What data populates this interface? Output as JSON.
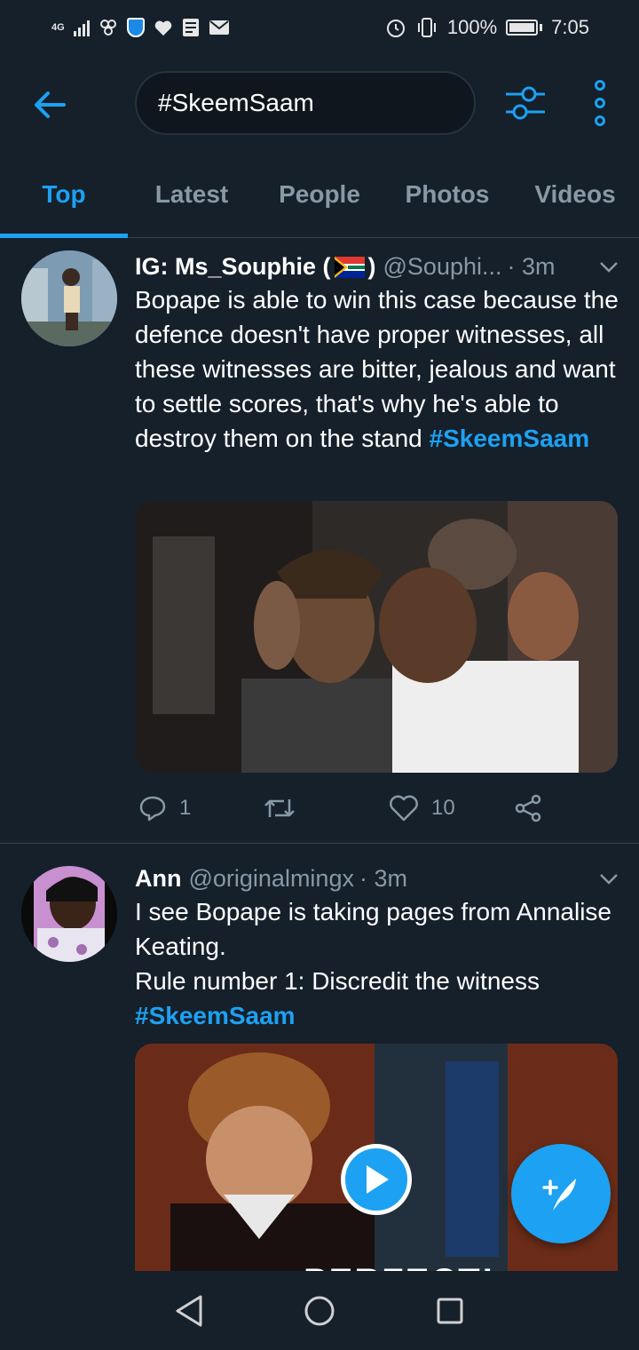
{
  "status_bar": {
    "network": "4G",
    "battery": "100%",
    "time": "7:05"
  },
  "search": {
    "query": "#SkeemSaam"
  },
  "tabs": [
    {
      "label": "Top",
      "active": true
    },
    {
      "label": "Latest",
      "active": false
    },
    {
      "label": "People",
      "active": false
    },
    {
      "label": "Photos",
      "active": false
    },
    {
      "label": "Videos",
      "active": false
    }
  ],
  "tweets": [
    {
      "author": "IG: Ms_Souphie (",
      "author_suffix": ")",
      "handle": "@Souphi...",
      "time": "· 3m",
      "text": "Bopape is able to win this case because the defence doesn't have proper witnesses, all these witnesses are bitter, jealous and want to settle scores, that's why he's able to destroy them on the stand ",
      "hashtag": "#SkeemSaam",
      "replies": "1",
      "retweets": "",
      "likes": "10"
    },
    {
      "author": "Ann",
      "handle": "@originalmingx",
      "time": "· 3m",
      "line1": "I see Bopape is taking pages from Annalise Keating.",
      "line2": "Rule number 1: Discredit the witness",
      "hashtag": "#SkeemSaam",
      "media_caption": "PERFECT!"
    }
  ],
  "colors": {
    "background": "#15202b",
    "accent": "#1da1f2",
    "secondary_text": "#8899a6",
    "divider": "#38444d"
  },
  "icons": {
    "back": "arrow-left-icon",
    "filter": "sliders-icon",
    "more": "more-vertical-icon",
    "reply": "reply-icon",
    "retweet": "retweet-icon",
    "like": "heart-icon",
    "share": "share-icon",
    "compose": "compose-tweet-icon",
    "play": "play-icon"
  }
}
